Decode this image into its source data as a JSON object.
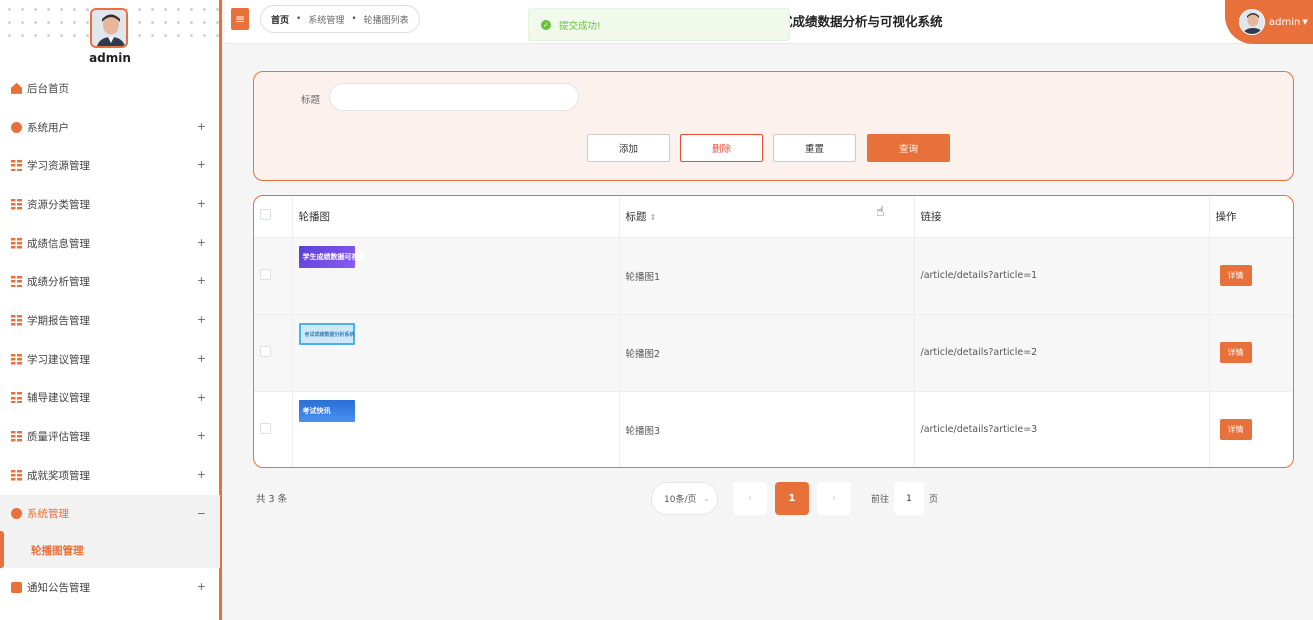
{
  "sidebar": {
    "username": "admin",
    "items": [
      {
        "label": "后台首页",
        "icon": "home-icon",
        "expand": ""
      },
      {
        "label": "系统用户",
        "icon": "user-icon",
        "expand": "+"
      },
      {
        "label": "学习资源管理",
        "icon": "grid-icon",
        "expand": "+"
      },
      {
        "label": "资源分类管理",
        "icon": "grid-icon",
        "expand": "+"
      },
      {
        "label": "成绩信息管理",
        "icon": "grid-icon",
        "expand": "+"
      },
      {
        "label": "成绩分析管理",
        "icon": "grid-icon",
        "expand": "+"
      },
      {
        "label": "学期报告管理",
        "icon": "grid-icon",
        "expand": "+"
      },
      {
        "label": "学习建议管理",
        "icon": "grid-icon",
        "expand": "+"
      },
      {
        "label": "辅导建议管理",
        "icon": "grid-icon",
        "expand": "+"
      },
      {
        "label": "质量评估管理",
        "icon": "grid-icon",
        "expand": "+"
      },
      {
        "label": "成就奖项管理",
        "icon": "grid-icon",
        "expand": "+"
      },
      {
        "label": "系统管理",
        "icon": "gear-icon",
        "expand": "−"
      },
      {
        "label": "轮播图管理",
        "icon": "",
        "expand": ""
      },
      {
        "label": "通知公告管理",
        "icon": "doc-icon",
        "expand": "+"
      }
    ]
  },
  "topbar": {
    "menu_icon": "≡",
    "breadcrumb": [
      "首页",
      "系统管理",
      "轮播图列表"
    ],
    "toast": "提交成功!",
    "system_title": "式成绩数据分析与可视化系统",
    "user": "admin"
  },
  "search": {
    "title_label": "标题",
    "title_value": "",
    "buttons": {
      "add": "添加",
      "delete": "删除",
      "reset": "重置",
      "query": "查询"
    }
  },
  "table": {
    "headers": {
      "image": "轮播图",
      "title": "标题",
      "link": "链接",
      "action": "操作"
    },
    "sort_icon": "sort-icon",
    "rows": [
      {
        "thumb_text": "学生成绩数据可视化",
        "title": "轮播图1",
        "link": "/article/details?article=1",
        "action": "详情"
      },
      {
        "thumb_text": "考试成绩数据分析系统",
        "title": "轮播图2",
        "link": "/article/details?article=2",
        "action": "详情"
      },
      {
        "thumb_text": "考试快讯",
        "title": "轮播图3",
        "link": "/article/details?article=3",
        "action": "详情"
      }
    ]
  },
  "pagination": {
    "total": "共 3 条",
    "page_size": "10条/页",
    "current_page": "1",
    "goto_prefix": "前往",
    "goto_value": "1",
    "goto_suffix": "页"
  },
  "colors": {
    "accent": "#e8703a",
    "success": "#67c23a",
    "danger": "#e84c3d"
  }
}
